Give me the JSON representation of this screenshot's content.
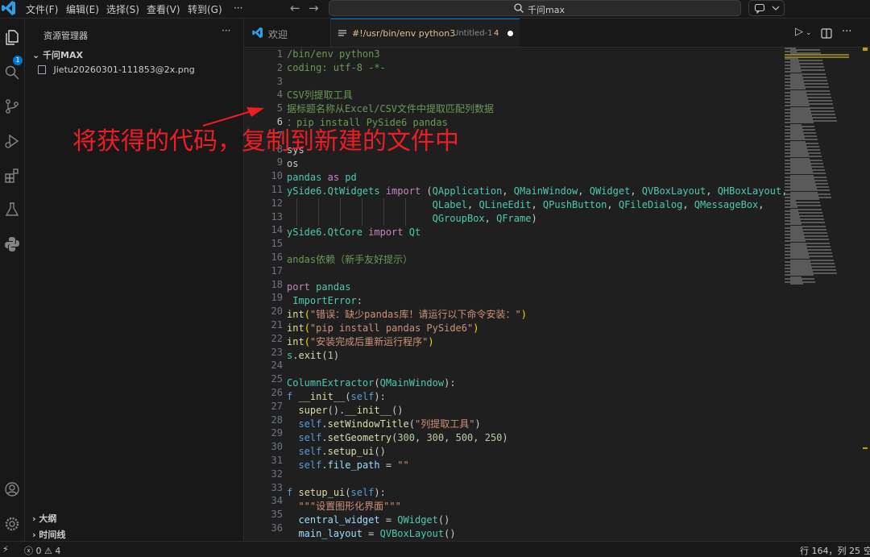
{
  "titlebar": {
    "menu": [
      "文件(F)",
      "编辑(E)",
      "选择(S)",
      "查看(V)",
      "转到(G)"
    ],
    "more": "···",
    "search_text": "千问max"
  },
  "sidebar": {
    "title": "资源管理器",
    "more": "···",
    "folder": "千问MAX",
    "file": "Jietu20260301-111853@2x.png",
    "outline": "大纲",
    "timeline": "时间线",
    "badge": "1"
  },
  "tabs": {
    "welcome": "欢迎",
    "file_title": "#!/usr/bin/env python3",
    "file_sub": "Untitled-1",
    "file_count": "4"
  },
  "editor": {
    "line_numbers": [
      "1",
      "2",
      "3",
      "4",
      "5",
      "6",
      "7",
      "8",
      "9",
      "10",
      "11",
      "12",
      "13",
      "14",
      "15",
      "16",
      "17",
      "18",
      "19",
      "20",
      "21",
      "22",
      "23",
      "24",
      "25",
      "26",
      "27",
      "28",
      "29",
      "30",
      "31",
      "32",
      "33",
      "34",
      "35",
      "36"
    ],
    "current_line": "6"
  },
  "annotation": "将获得的代码，复制到新建的文件中",
  "statusbar": {
    "errors": "0",
    "warnings": "4",
    "position": "行 164，列 25",
    "extra": "空"
  },
  "colors": {
    "accent": "#0078d4",
    "annotation": "#ee1c25",
    "background": "#1f1f1f"
  }
}
